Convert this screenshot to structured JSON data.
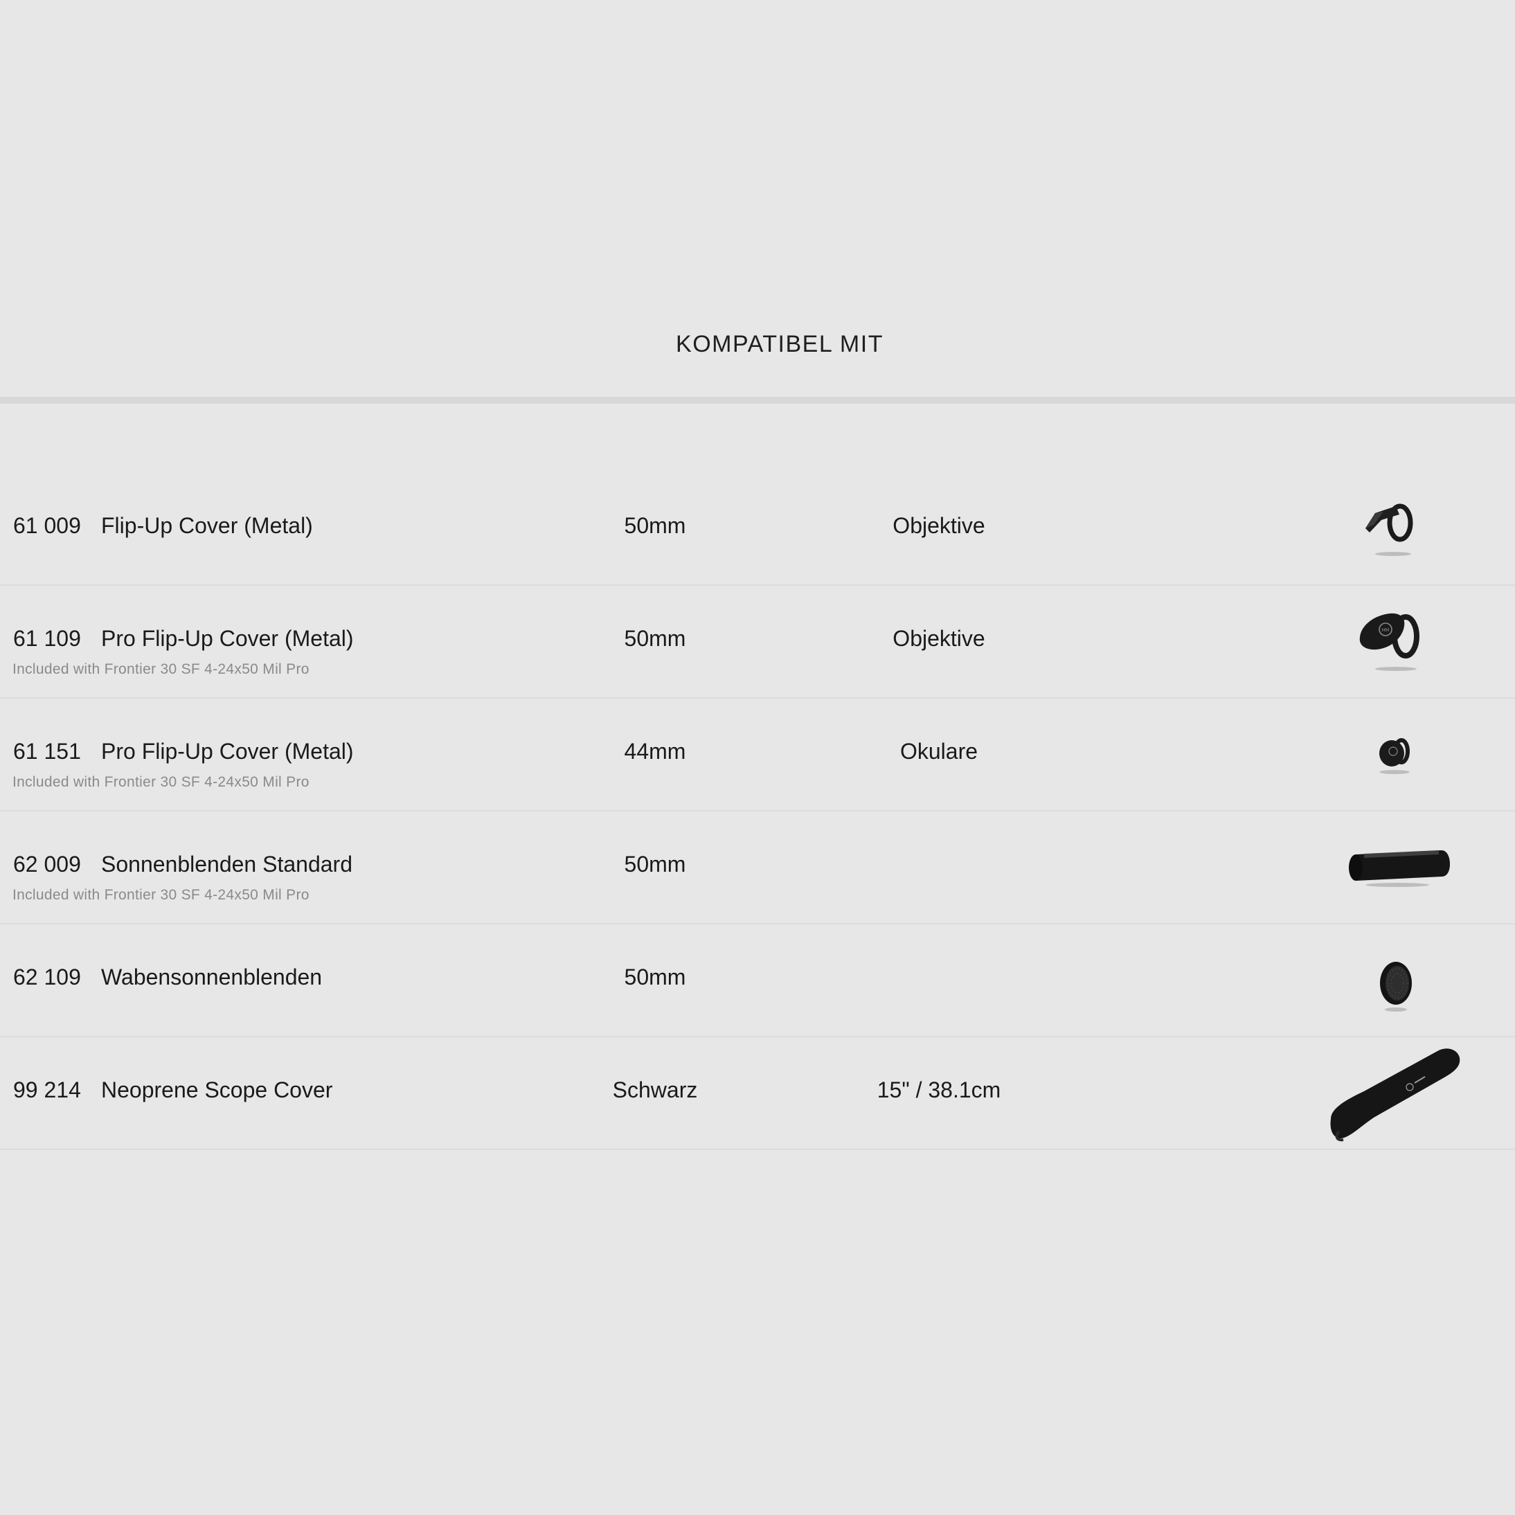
{
  "section": {
    "title": "KOMPATIBEL MIT"
  },
  "accessories": [
    {
      "sku": "61 009",
      "name": "Flip-Up Cover (Metal)",
      "note": "",
      "size": "50mm",
      "fits": "Objektive",
      "icon": "flip-up-cover-icon"
    },
    {
      "sku": "61 109",
      "name": "Pro Flip-Up Cover (Metal)",
      "note": "Included with Frontier 30 SF 4-24x50 Mil Pro",
      "size": "50mm",
      "fits": "Objektive",
      "icon": "pro-flip-up-cover-icon"
    },
    {
      "sku": "61 151",
      "name": "Pro Flip-Up Cover (Metal)",
      "note": "Included with Frontier 30 SF 4-24x50 Mil Pro",
      "size": "44mm",
      "fits": "Okulare",
      "icon": "eyepiece-cover-icon"
    },
    {
      "sku": "62 009",
      "name": "Sonnenblenden Standard",
      "note": "Included with Frontier 30 SF 4-24x50 Mil Pro",
      "size": "50mm",
      "fits": "",
      "icon": "sunshade-tube-icon"
    },
    {
      "sku": "62 109",
      "name": "Wabensonnenblenden",
      "note": "",
      "size": "50mm",
      "fits": "",
      "icon": "honeycomb-filter-icon"
    },
    {
      "sku": "99 214",
      "name": "Neoprene Scope Cover",
      "note": "",
      "size": "Schwarz",
      "fits": "15\" / 38.1cm",
      "icon": "neoprene-scope-cover-icon"
    }
  ],
  "colors": {
    "background": "#e7e7e7",
    "text": "#1a1a1a",
    "note_text": "#8a8a8a",
    "divider": "#dcdcdc",
    "product": "#1b1b1b"
  }
}
